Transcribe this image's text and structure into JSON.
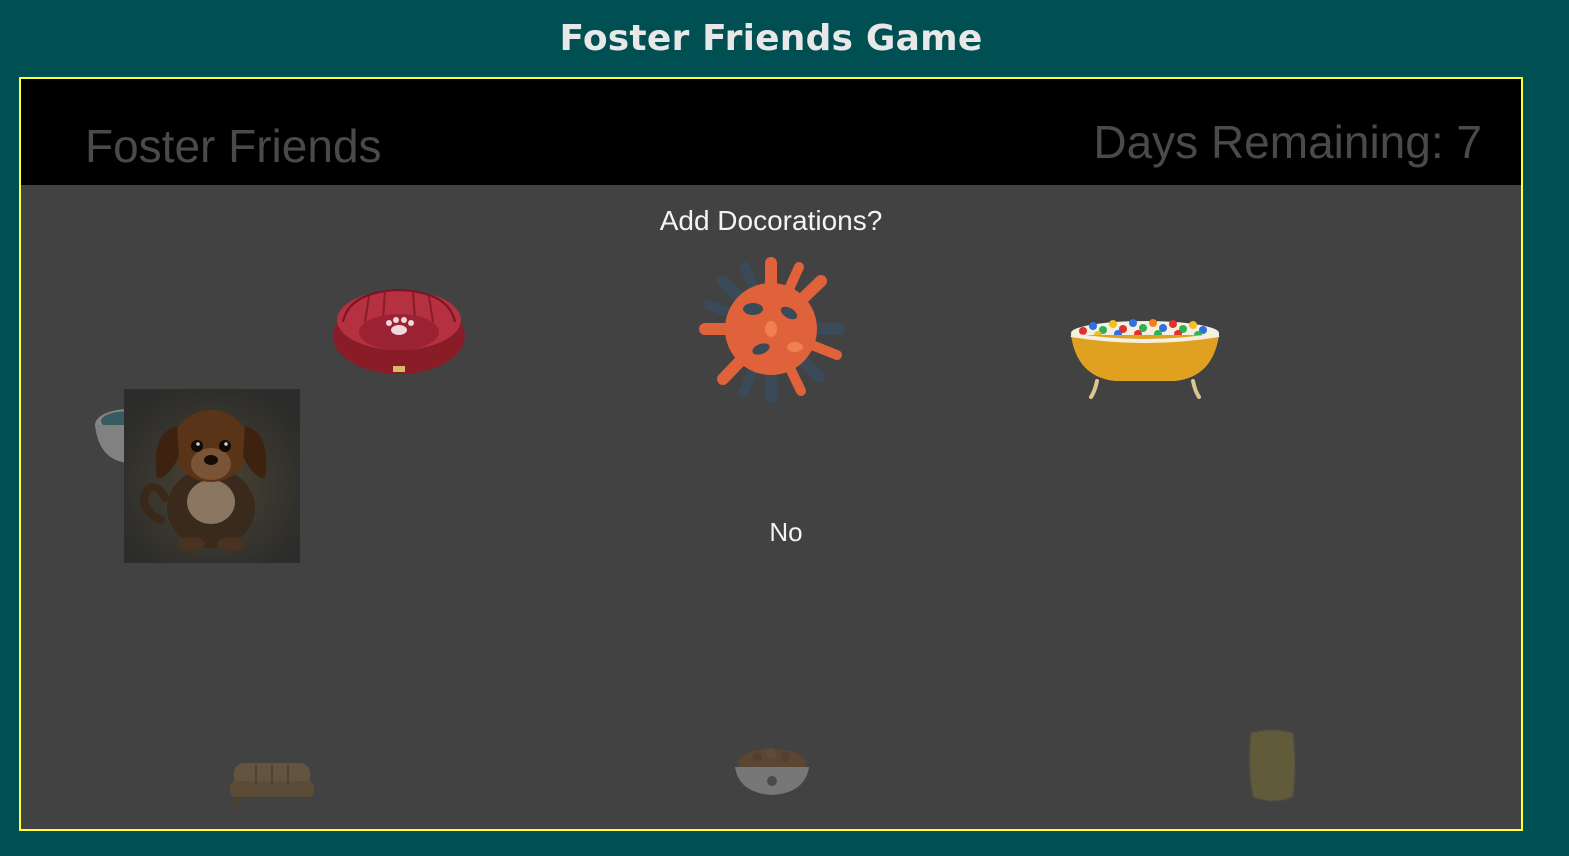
{
  "page": {
    "title": "Foster Friends Game"
  },
  "game": {
    "brand": "Foster Friends",
    "days_remaining_text": "Days Remaining: 7",
    "days_remaining": 7
  },
  "decoration_prompt": {
    "question": "Add Docorations?",
    "options": [
      {
        "icon": "pet-bed-icon"
      },
      {
        "icon": "spiky-ball-toy-icon"
      },
      {
        "icon": "ball-pit-bathtub-icon"
      }
    ],
    "decline_label": "No"
  },
  "room": {
    "pet": {
      "icon": "puppy-icon"
    },
    "items": [
      {
        "icon": "water-bowl-icon"
      },
      {
        "icon": "sofa-icon"
      },
      {
        "icon": "food-bowl-icon"
      },
      {
        "icon": "scratch-mat-icon"
      }
    ]
  },
  "colors": {
    "background": "#004f52",
    "frame_border": "#ffff33",
    "game_bg": "#424242",
    "header_bg": "#000000"
  }
}
